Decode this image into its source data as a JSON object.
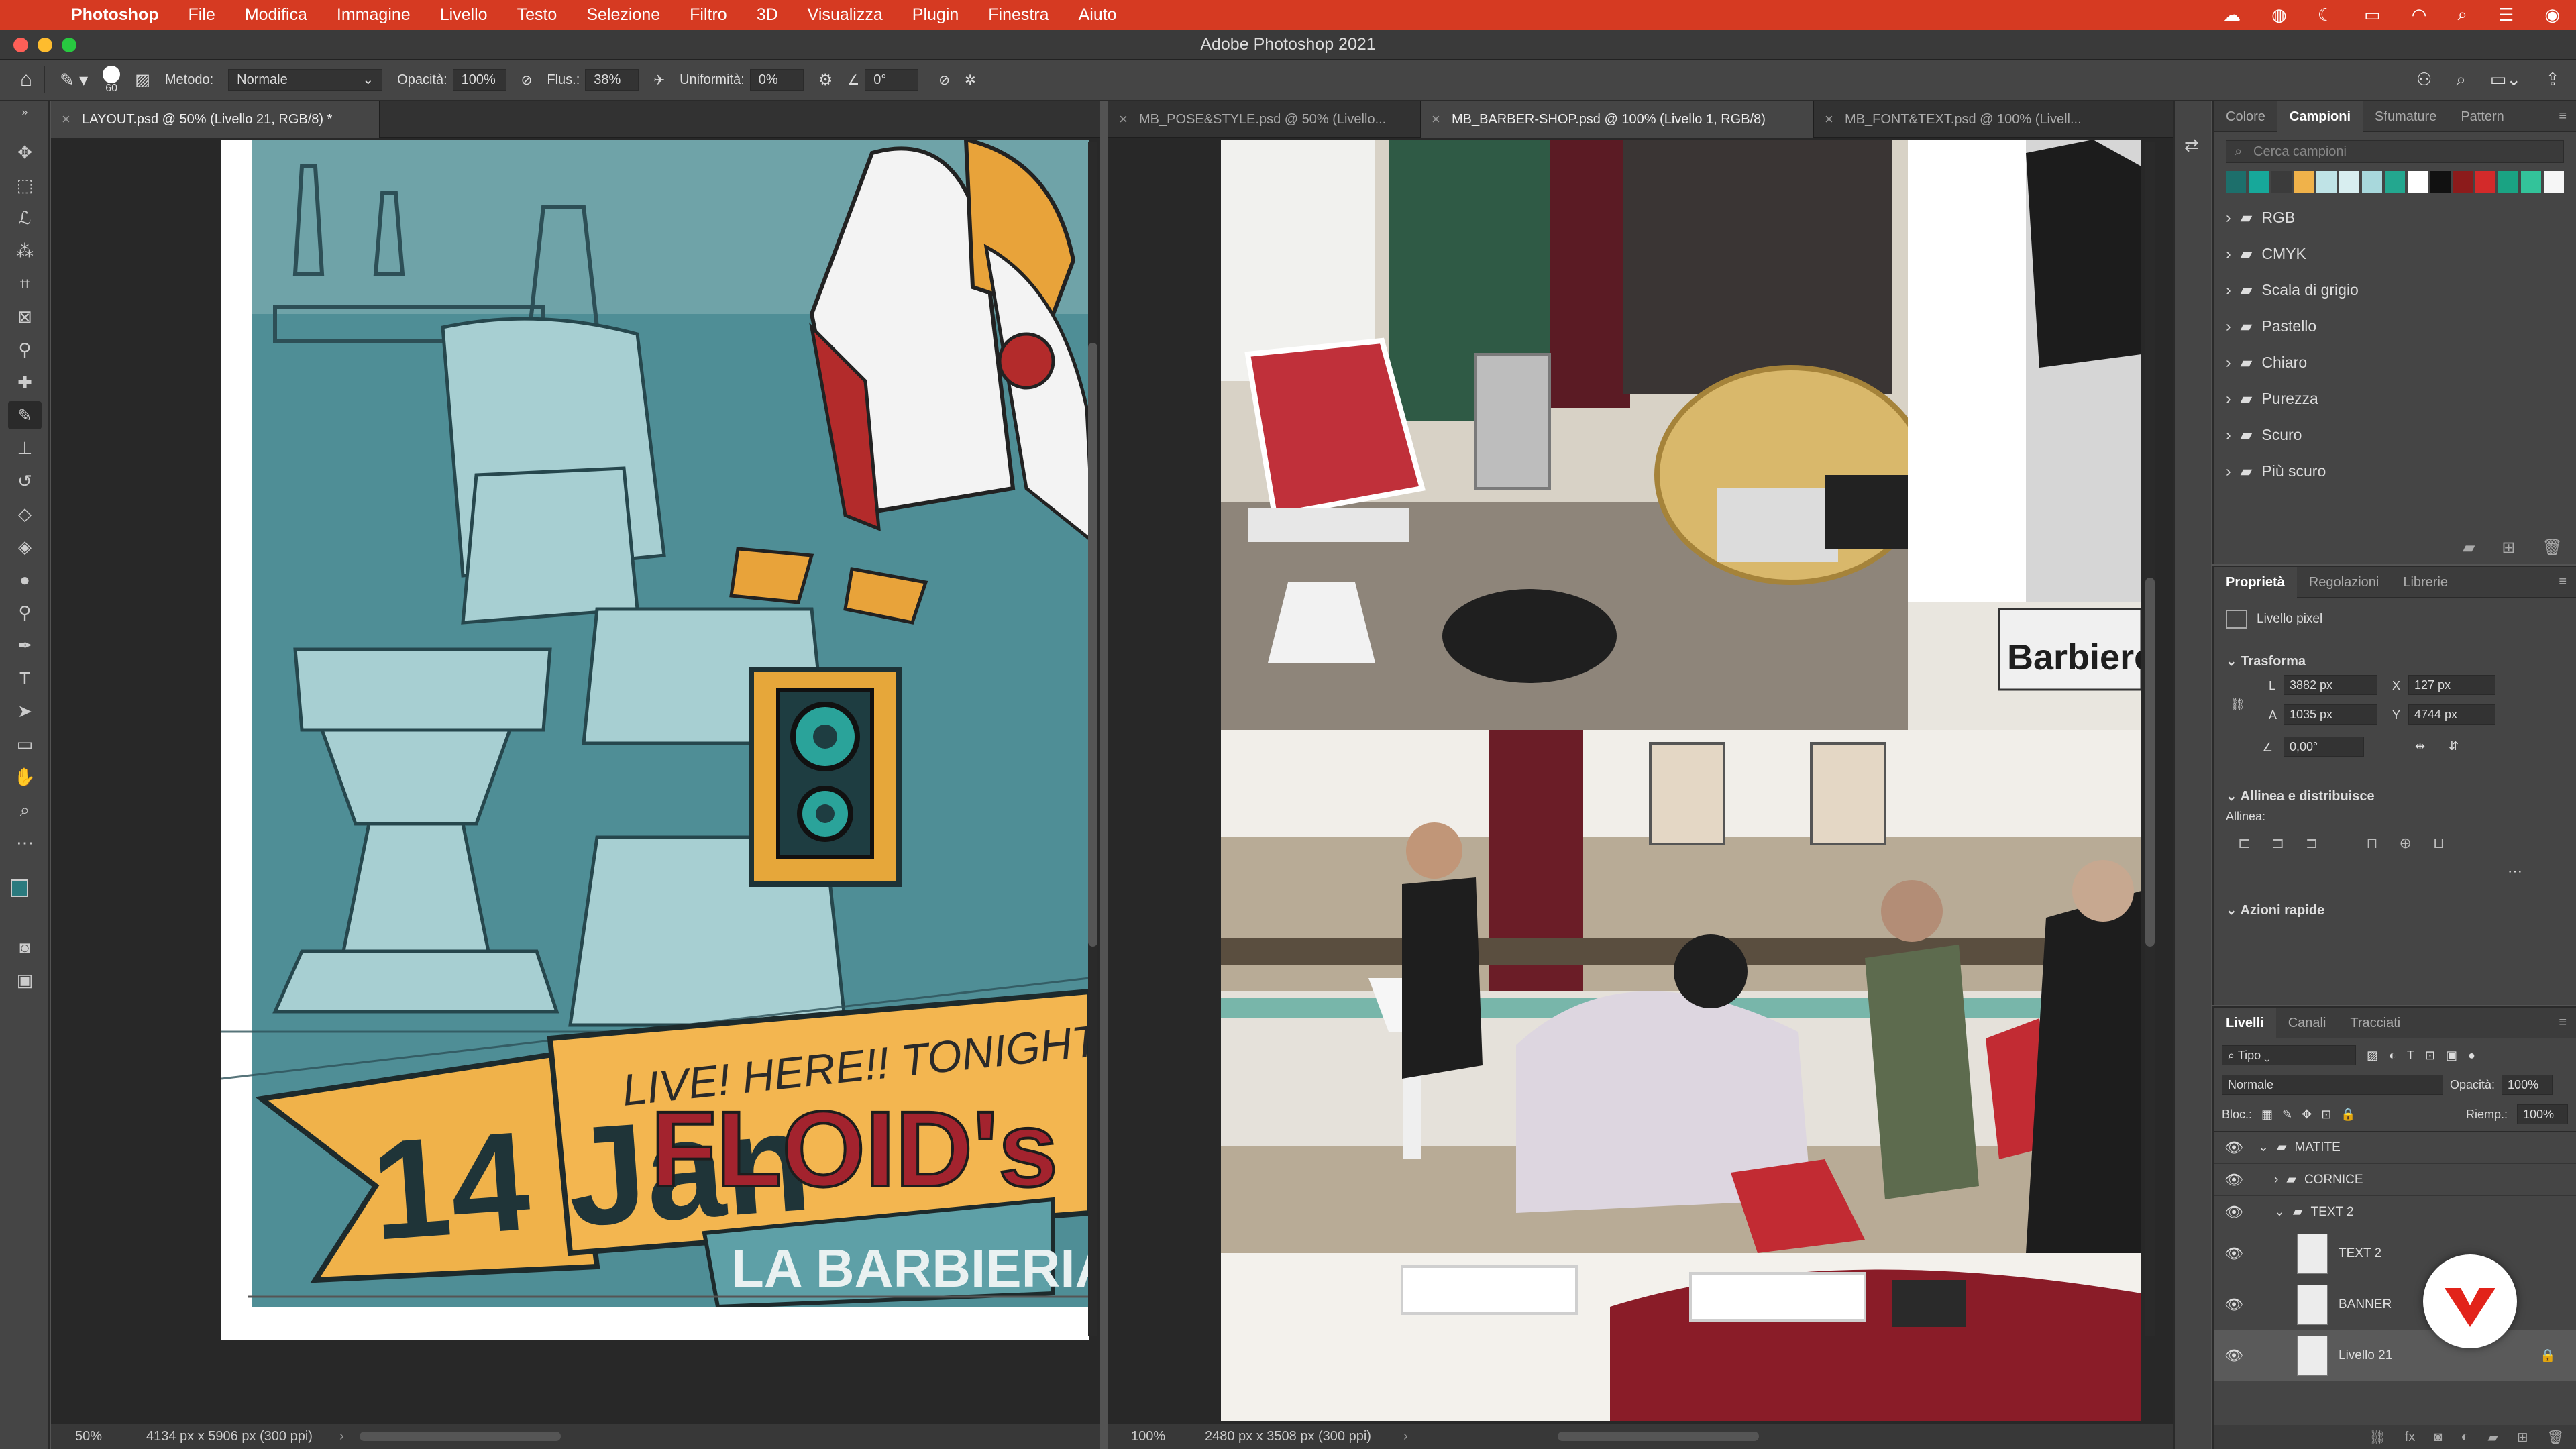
{
  "menubar": {
    "app": "Photoshop",
    "items": [
      "File",
      "Modifica",
      "Immagine",
      "Livello",
      "Testo",
      "Selezione",
      "Filtro",
      "3D",
      "Visualizza",
      "Plugin",
      "Finestra",
      "Aiuto"
    ]
  },
  "window_title": "Adobe Photoshop 2021",
  "options": {
    "brush_size": "60",
    "method_label": "Metodo:",
    "method_value": "Normale",
    "opacity_label": "Opacità:",
    "opacity_value": "100%",
    "flow_label": "Flus.:",
    "flow_value": "38%",
    "smooth_label": "Uniformità:",
    "smooth_value": "0%",
    "angle_value": "0°"
  },
  "left_doc": {
    "tab": "LAYOUT.psd @ 50% (Livello 21, RGB/8) *",
    "zoom": "50%",
    "info": "4134 px x 5906 px (300 ppi)"
  },
  "right_doc": {
    "tabs": [
      "MB_POSE&STYLE.psd @ 50% (Livello...",
      "MB_BARBER-SHOP.psd @ 100% (Livello 1, RGB/8)",
      "MB_FONT&TEXT.psd @ 100% (Livell..."
    ],
    "zoom": "100%",
    "info": "2480 px x 3508 px (300 ppi)"
  },
  "artwork": {
    "date": "14 Jan",
    "tagline": "LIVE! HERE!! TONIGHT!!",
    "title": "FLOID's",
    "subtitle": "LA BARBIERIA",
    "sign": "Barbiere"
  },
  "swatches_panel": {
    "tabs": [
      "Colore",
      "Campioni",
      "Sfumature",
      "Pattern"
    ],
    "active": "Campioni",
    "search_placeholder": "Cerca campioni",
    "colors": [
      "#1d6f6b",
      "#17a89a",
      "#3b3b3b",
      "#f0b24a",
      "#bfe3e6",
      "#d8eef0",
      "#a8d8dc",
      "#23a78f",
      "#ffffff",
      "#111111",
      "#8c1b1b",
      "#d32a2a",
      "#1aa383",
      "#33c39a",
      "#f6f6f6"
    ],
    "folders": [
      "RGB",
      "CMYK",
      "Scala di grigio",
      "Pastello",
      "Chiaro",
      "Purezza",
      "Scuro",
      "Più scuro"
    ]
  },
  "properties_panel": {
    "tabs": [
      "Proprietà",
      "Regolazioni",
      "Librerie"
    ],
    "active": "Proprietà",
    "layer_type": "Livello pixel",
    "transform_title": "Trasforma",
    "w_label": "L",
    "w_value": "3882 px",
    "x_label": "X",
    "x_value": "127 px",
    "h_label": "A",
    "h_value": "1035 px",
    "y_label": "Y",
    "y_value": "4744 px",
    "angle_value": "0,00°",
    "align_title": "Allinea e distribuisce",
    "align_label": "Allinea:",
    "quick_title": "Azioni rapide"
  },
  "layers_panel": {
    "tabs": [
      "Livelli",
      "Canali",
      "Tracciati"
    ],
    "active": "Livelli",
    "filter": "Tipo",
    "blend": "Normale",
    "opacity_label": "Opacità:",
    "opacity_value": "100%",
    "lock_label": "Bloc.:",
    "fill_label": "Riemp.:",
    "fill_value": "100%",
    "layers": [
      {
        "name": "MATITE",
        "type": "group",
        "indent": 0
      },
      {
        "name": "CORNICE",
        "type": "group",
        "indent": 1
      },
      {
        "name": "TEXT 2",
        "type": "group",
        "indent": 1
      },
      {
        "name": "TEXT 2",
        "type": "layer",
        "indent": 2
      },
      {
        "name": "BANNER",
        "type": "layer",
        "indent": 2
      },
      {
        "name": "Livello 21",
        "type": "layer",
        "indent": 2
      }
    ]
  }
}
